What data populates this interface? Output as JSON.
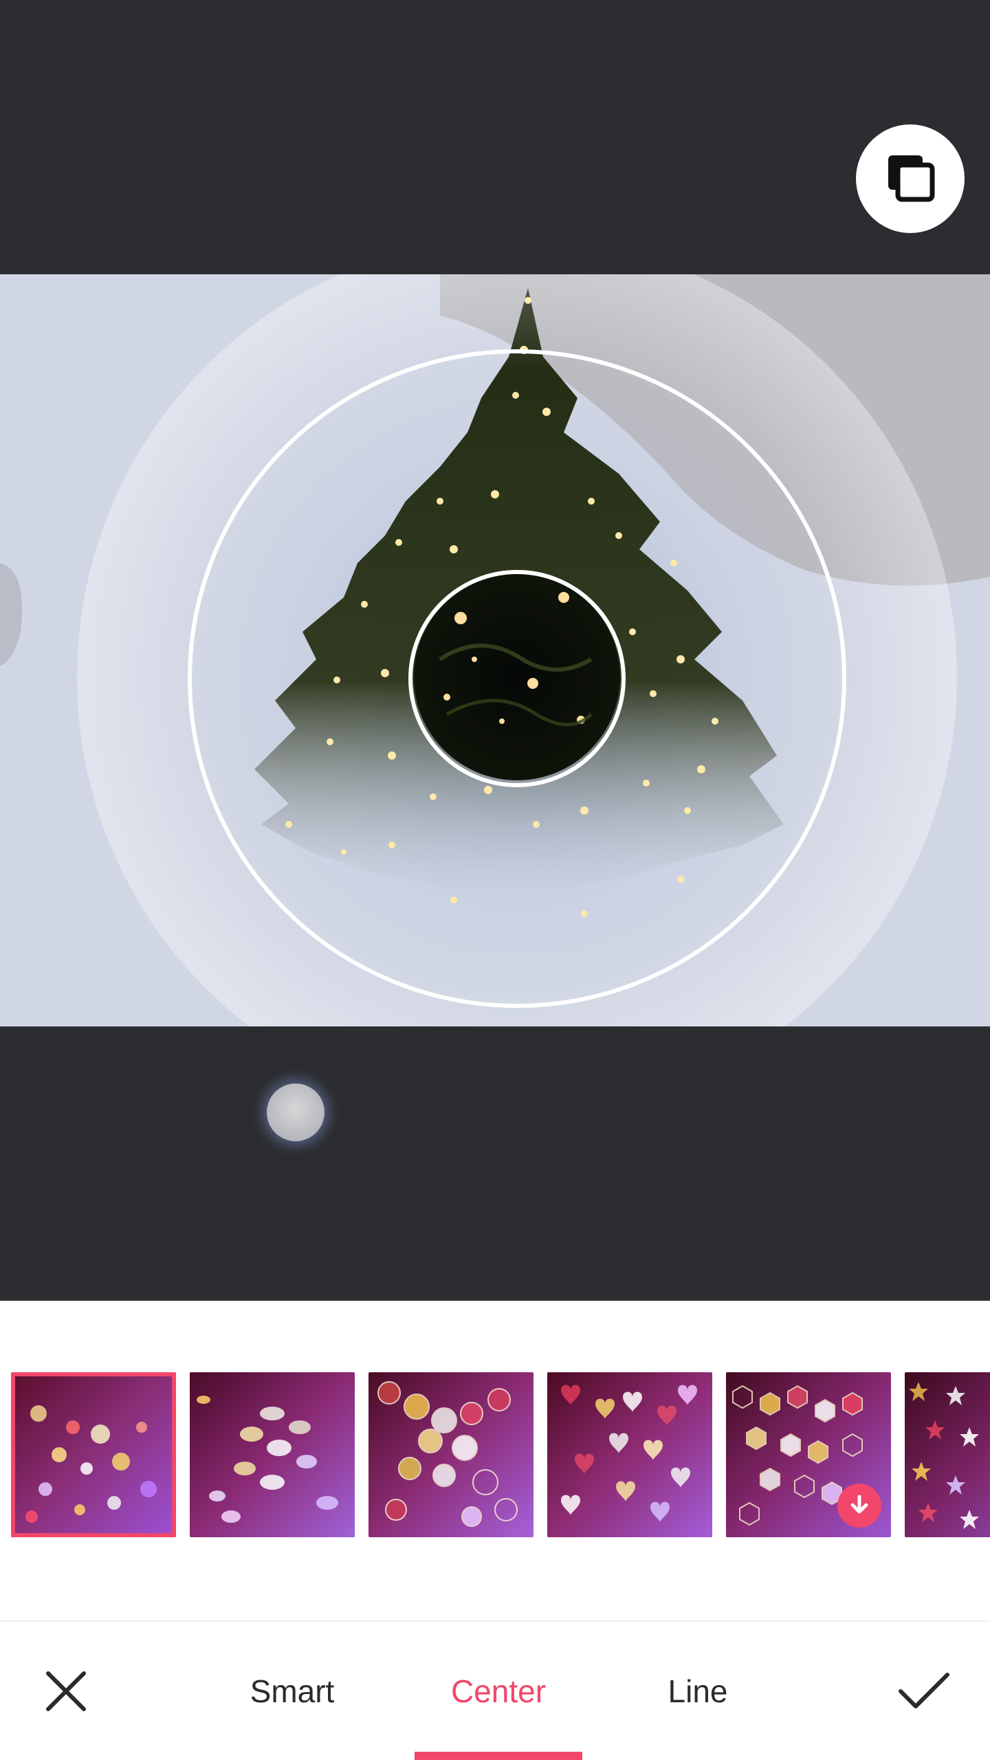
{
  "toolbar": {
    "cancel_icon": "close-icon",
    "confirm_icon": "check-icon",
    "tabs": [
      {
        "label": "Smart",
        "active": false
      },
      {
        "label": "Center",
        "active": true
      },
      {
        "label": "Line",
        "active": false
      }
    ]
  },
  "compare_icon": "compare-layers-icon",
  "filters": [
    {
      "name": "bokeh-dots",
      "selected": true,
      "downloadable": false
    },
    {
      "name": "bokeh-swirl",
      "selected": false,
      "downloadable": false
    },
    {
      "name": "bokeh-hexagon-circles",
      "selected": false,
      "downloadable": false
    },
    {
      "name": "bokeh-hearts",
      "selected": false,
      "downloadable": false
    },
    {
      "name": "bokeh-hexagons",
      "selected": false,
      "downloadable": true
    },
    {
      "name": "bokeh-stars",
      "selected": false,
      "downloadable": false
    }
  ],
  "colors": {
    "accent": "#f2466a",
    "dark_background": "#2c2d30",
    "panel_background": "#ffffff"
  },
  "slider": {
    "value": 0.2
  }
}
